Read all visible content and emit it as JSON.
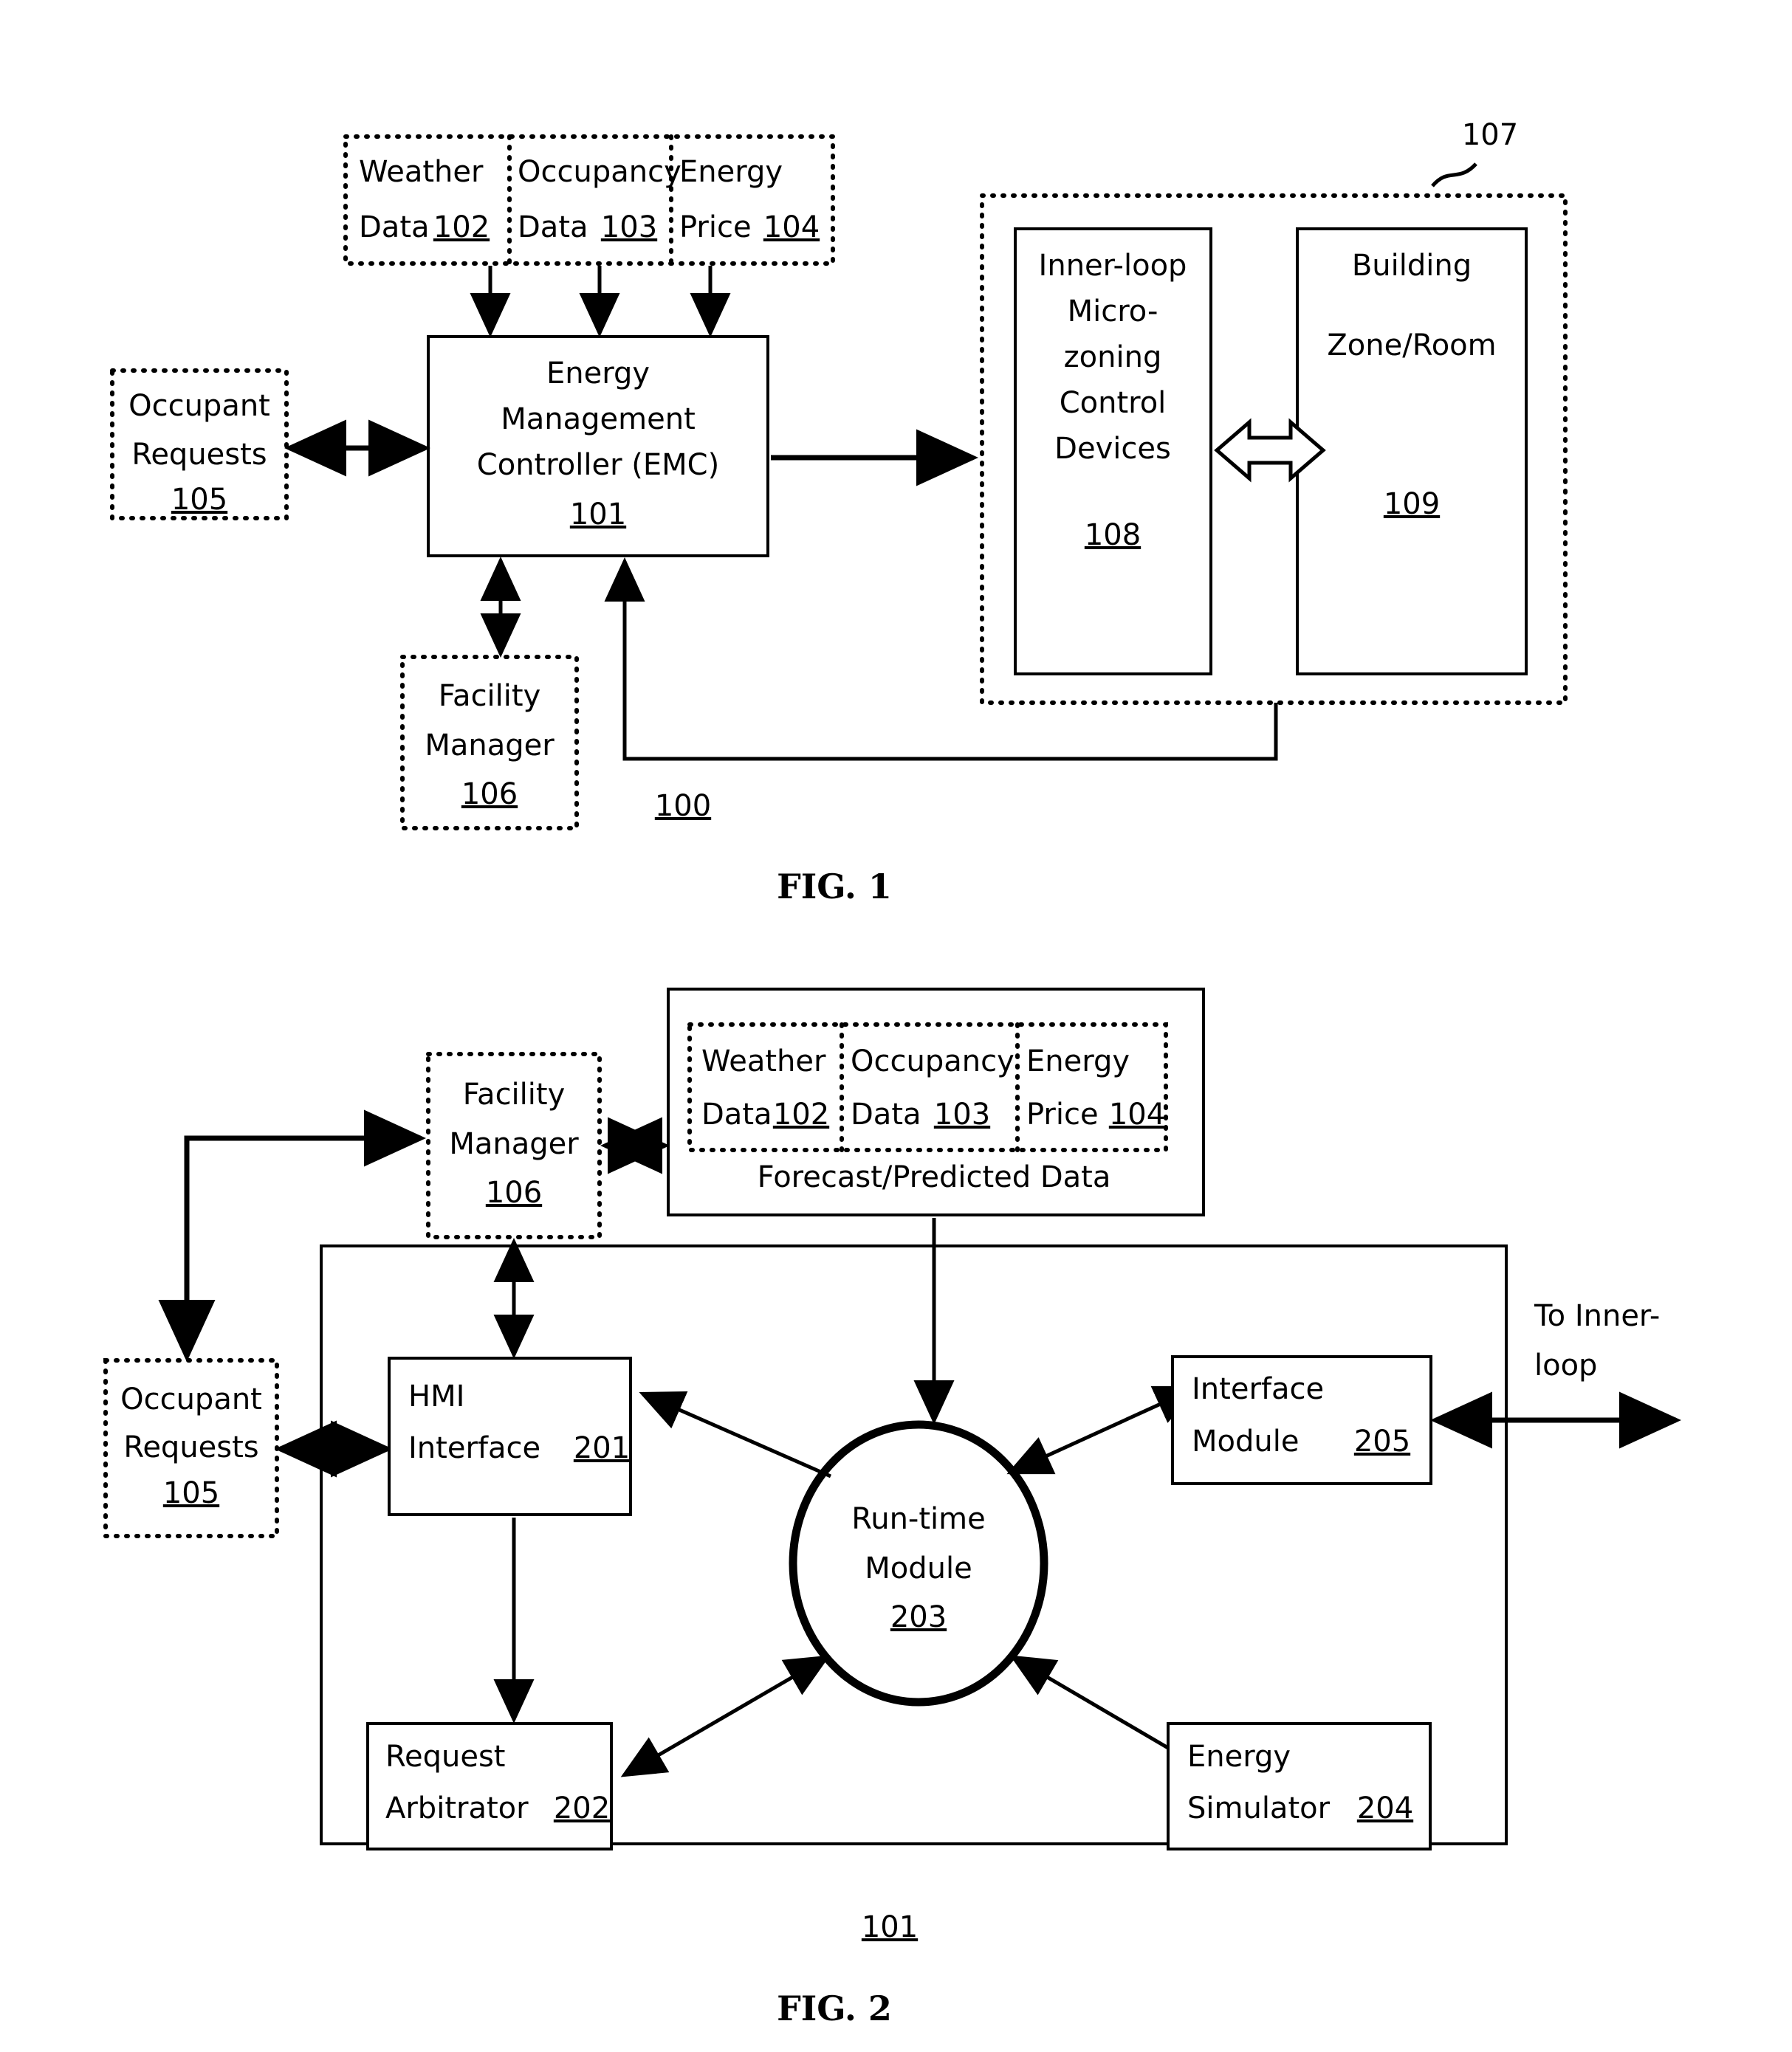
{
  "document": {
    "type": "patent-drawing-sheet"
  },
  "fig1": {
    "caption": "FIG. 1",
    "system_ref": "100",
    "group_ref": "107",
    "inputs": [
      {
        "line1": "Weather",
        "line2": "Data",
        "ref": "102"
      },
      {
        "line1": "Occupancy",
        "line2": "Data",
        "ref": "103"
      },
      {
        "line1": "Energy",
        "line2": "Price",
        "ref": "104"
      }
    ],
    "emc": {
      "line1": "Energy",
      "line2": "Management",
      "line3": "Controller (EMC)",
      "ref": "101"
    },
    "occupant_requests": {
      "line1": "Occupant",
      "line2": "Requests",
      "ref": "105"
    },
    "facility_manager": {
      "line1": "Facility",
      "line2": "Manager",
      "ref": "106"
    },
    "inner_loop_devices": {
      "line1": "Inner-loop",
      "line2": "Micro-",
      "line3": "zoning",
      "line4": "Control",
      "line5": "Devices",
      "ref": "108"
    },
    "building_zone": {
      "line1": "Building",
      "line2": "Zone/Room",
      "ref": "109"
    }
  },
  "fig2": {
    "caption": "FIG. 2",
    "controller_ref": "101",
    "facility_manager": {
      "line1": "Facility",
      "line2": "Manager",
      "ref": "106"
    },
    "forecast_panel": {
      "label": "Forecast/Predicted Data",
      "inputs": [
        {
          "line1": "Weather",
          "line2": "Data",
          "ref": "102"
        },
        {
          "line1": "Occupancy",
          "line2": "Data",
          "ref": "103"
        },
        {
          "line1": "Energy",
          "line2": "Price",
          "ref": "104"
        }
      ]
    },
    "occupant_requests": {
      "line1": "Occupant",
      "line2": "Requests",
      "ref": "105"
    },
    "hmi_interface": {
      "line1": "HMI",
      "line2": "Interface",
      "ref": "201"
    },
    "request_arbitrator": {
      "line1": "Request",
      "line2": "Arbitrator",
      "ref": "202"
    },
    "runtime_module": {
      "line1": "Run-time",
      "line2": "Module",
      "ref": "203"
    },
    "energy_simulator": {
      "line1": "Energy",
      "line2": "Simulator",
      "ref": "204"
    },
    "interface_module": {
      "line1": "Interface",
      "line2": "Module",
      "ref": "205"
    },
    "to_inner_loop": {
      "line1": "To Inner-",
      "line2": "loop"
    }
  }
}
